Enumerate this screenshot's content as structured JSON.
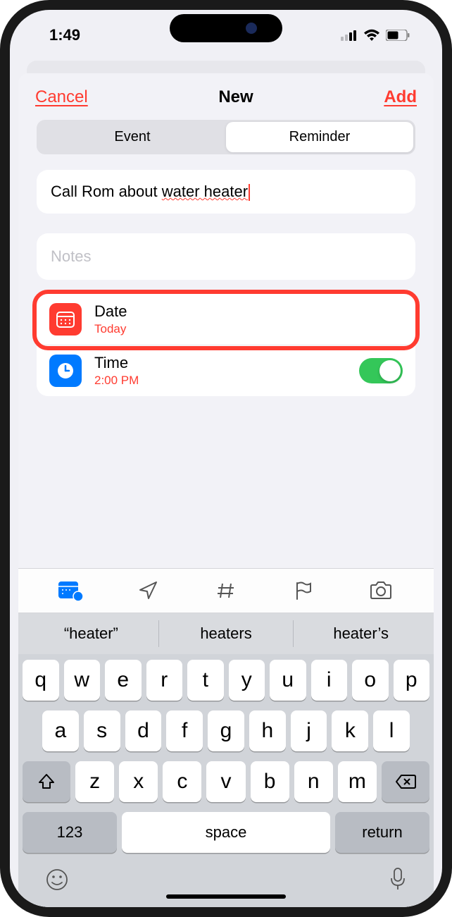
{
  "status": {
    "time": "1:49"
  },
  "nav": {
    "cancel": "Cancel",
    "title": "New",
    "add": "Add"
  },
  "seg": {
    "event": "Event",
    "reminder": "Reminder"
  },
  "fields": {
    "title_prefix": "Call Rom about ",
    "title_err": "water heater",
    "notes_placeholder": "Notes"
  },
  "date": {
    "label": "Date",
    "value": "Today"
  },
  "time": {
    "label": "Time",
    "value": "2:00 PM"
  },
  "suggestions": [
    "“heater”",
    "heaters",
    "heater’s"
  ],
  "keys": {
    "r1": [
      "q",
      "w",
      "e",
      "r",
      "t",
      "y",
      "u",
      "i",
      "o",
      "p"
    ],
    "r2": [
      "a",
      "s",
      "d",
      "f",
      "g",
      "h",
      "j",
      "k",
      "l"
    ],
    "r3": [
      "z",
      "x",
      "c",
      "v",
      "b",
      "n",
      "m"
    ],
    "num": "123",
    "space": "space",
    "return": "return"
  }
}
